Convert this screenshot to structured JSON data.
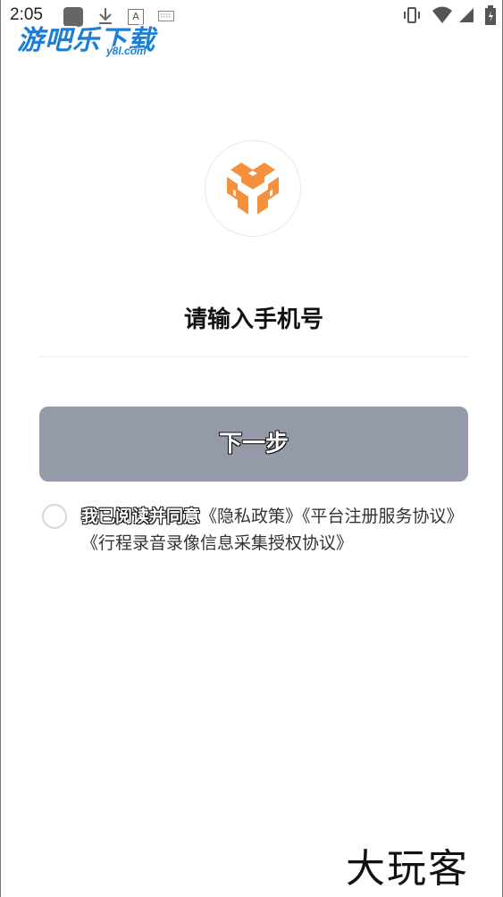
{
  "status_bar": {
    "time": "2:05",
    "icons": [
      "notification-square-icon",
      "download-icon",
      "a-icon",
      "keyboard-icon",
      "vibrate-icon",
      "wifi-icon",
      "signal-icon",
      "battery-icon"
    ]
  },
  "watermark": {
    "title": "游吧乐下载",
    "subtitle": "y8l.com"
  },
  "app_logo": {
    "icon": "orange-cube-logo-icon",
    "color": "#f5913d"
  },
  "login": {
    "phone_placeholder": "请输入手机号",
    "phone_value": "",
    "next_label": "下一步",
    "next_button_color": "#959aa8"
  },
  "agreement": {
    "checked": false,
    "prefix": "我已阅读并同意",
    "links": [
      "《隐私政策》",
      "《平台注册服务协议》",
      "《行程录音录像信息采集授权协议》"
    ]
  },
  "brand": {
    "text": "大玩客"
  }
}
